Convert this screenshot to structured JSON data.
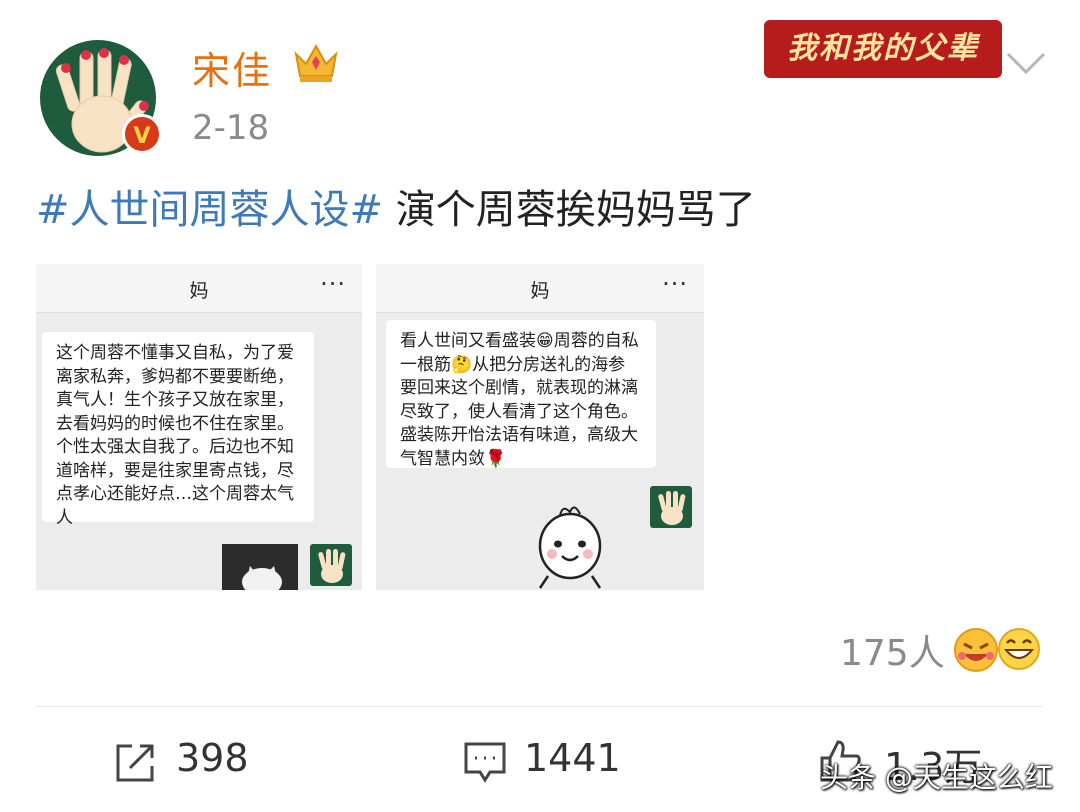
{
  "post": {
    "username": "宋佳",
    "time": "2-18",
    "banner_text": "我和我的父辈",
    "verified_badge": "V",
    "hashtag": "#人世间周蓉人设#",
    "text": " 演个周蓉挨妈妈骂了",
    "icons": [
      "avatar-hand-icon",
      "crown-icon",
      "chevron-down-icon",
      "share-icon",
      "comment-icon",
      "like-icon"
    ]
  },
  "images": [
    {
      "title": "妈",
      "more": "···",
      "message": "这个周蓉不懂事又自私，为了爱离家私奔，爹妈都不要要断绝，真气人！生个孩子又放在家里，去看妈妈的时候也不住在家里。个性太强太自我了。后边也不知道啥样，要是往家里寄点钱，尽点孝心还能好点…这个周蓉太气人"
    },
    {
      "title": "妈",
      "more": "···",
      "message": "看人世间又看盛装😁周蓉的自私一根筋🤔从把分房送礼的海参要回来这个剧情，就表现的淋漓尽致了，使人看清了这个角色。盛装陈开怡法语有味道，高级大气智慧内敛🌹"
    }
  ],
  "likes": {
    "count": "175人"
  },
  "actions": {
    "share_count": "398",
    "comment_count": "1441",
    "like_count": "1.3万"
  },
  "watermark": "头条 @天生这么红",
  "colors": {
    "username": "#e8700e",
    "hashtag": "#3e7ab6",
    "meta": "#8a8a8a"
  }
}
